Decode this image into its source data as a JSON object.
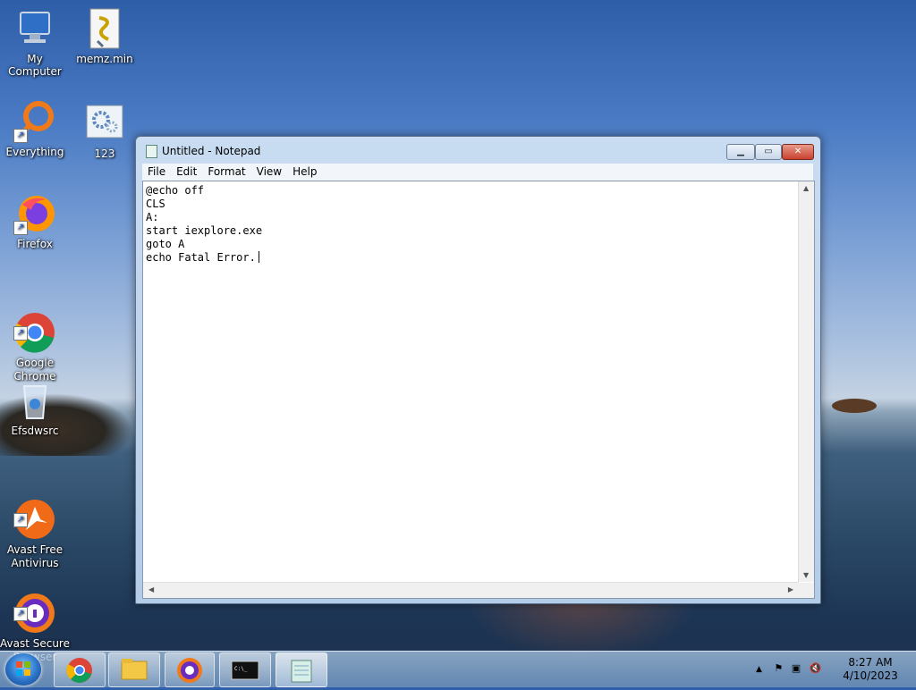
{
  "desktop": {
    "icons": [
      {
        "label": "My Computer"
      },
      {
        "label": "memz.min"
      },
      {
        "label": "Everything"
      },
      {
        "label": "123"
      },
      {
        "label": "Firefox"
      },
      {
        "label": "Google\nChrome"
      },
      {
        "label": "Efsdwsrc"
      },
      {
        "label": "Avast Free\nAntivirus"
      },
      {
        "label": "Avast Secure\nBrowser"
      }
    ]
  },
  "notepad": {
    "title": "Untitled - Notepad",
    "menu": [
      "File",
      "Edit",
      "Format",
      "View",
      "Help"
    ],
    "content": "@echo off\nCLS\nA:\nstart iexplore.exe\ngoto A\necho Fatal Error."
  },
  "taskbar": {
    "time": "8:27 AM",
    "date": "4/10/2023",
    "show_hidden": "▲"
  },
  "colors": {
    "titlebar": "#c9dcf1",
    "close_button": "#c8412e"
  }
}
